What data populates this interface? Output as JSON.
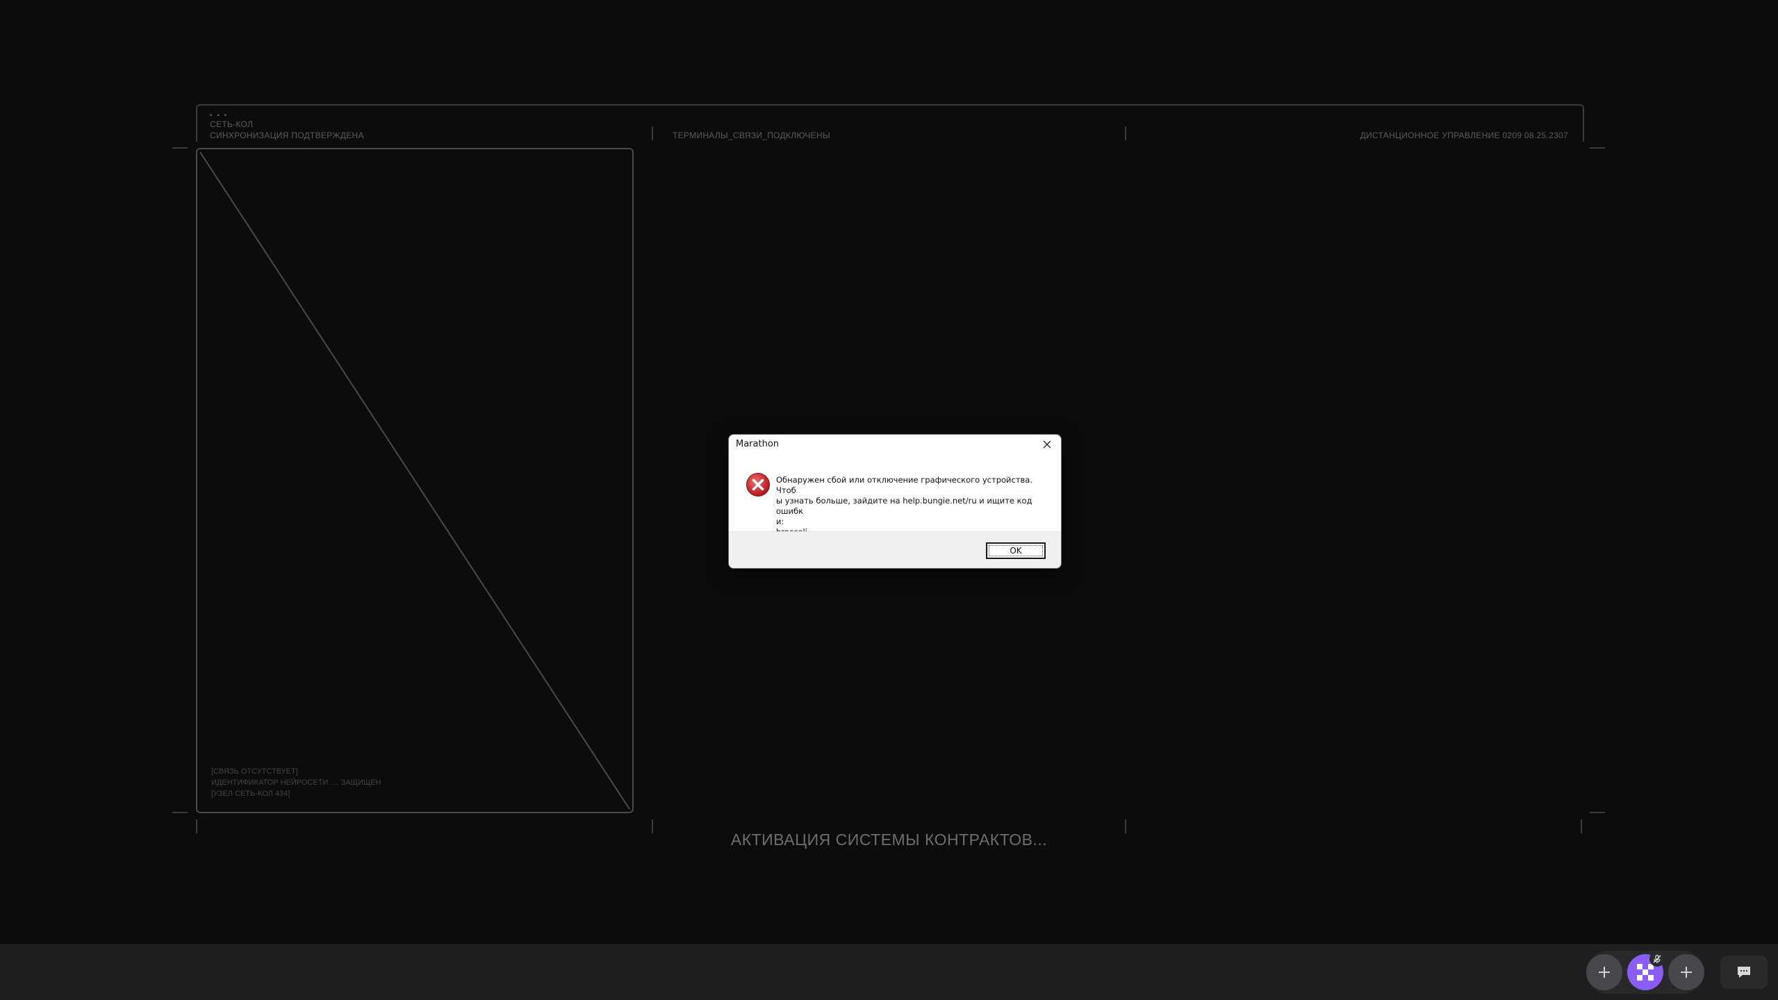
{
  "hud": {
    "dots": "▪ ▪ ▪",
    "net_label": "СЕТЬ-КОЛ",
    "sync_label": "СИНХРОНИЗАЦИЯ ПОДТВЕРЖДЕНА",
    "terminals_label": "ТЕРМИНАЛЫ_СВЯЗИ_ПОДКЛЮЧЕНЫ",
    "remote_label": "ДИСТАНЦИОННОЕ УПРАВЛЕНИЕ 0209 08.25.2307"
  },
  "panel": {
    "footer": [
      "[СВЯЗЬ ОТСУТСТВУЕТ]",
      "ИДЕНТИФИКАТОР НЕЙРОСЕТИ .... ЗАЩИЩЕН",
      "[УЗЕЛ СЕТЬ-КОЛ 434]"
    ]
  },
  "activation_text": "АКТИВАЦИЯ СИСТЕМЫ КОНТРАКТОВ...",
  "dialog": {
    "title": "Marathon",
    "message_lines": [
      "Обнаружен сбой или отключение графического устройства. Чтоб",
      "ы узнать больше, зайдите на help.bungie.net/ru и ищите код ошибк",
      "и:",
      "broccoli"
    ],
    "ok_label": "OK",
    "icons": {
      "close": "close-icon",
      "error": "error-icon"
    }
  },
  "taskbar": {
    "icons": [
      "crosshair-icon",
      "app-launcher-icon",
      "mic-muted-icon",
      "crosshair-icon",
      "chat-icon"
    ],
    "accent_color": "#8b5cf6"
  }
}
